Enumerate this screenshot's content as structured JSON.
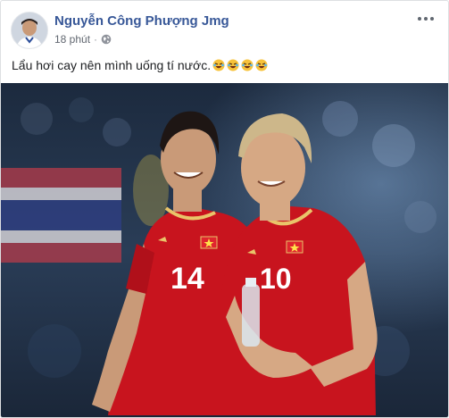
{
  "post": {
    "author_name": "Nguyễn Công Phượng Jmg",
    "timestamp": "18 phút",
    "separator": "·",
    "privacy_icon": "globe-icon",
    "menu_icon": "more-options-icon",
    "text": "Lẩu hơi cay nên mình uống tí nước.",
    "emoji_icon": "rolling-laughing-emoji",
    "emoji_count": 4
  },
  "photo": {
    "description_icons": [
      "shirt-number-14",
      "shirt-number-10"
    ],
    "jersey_numbers": [
      "14",
      "10"
    ]
  },
  "colors": {
    "author_link": "#385898",
    "meta_text": "#616770",
    "jersey_red": "#c8141e",
    "jersey_gold": "#e9c46a"
  }
}
